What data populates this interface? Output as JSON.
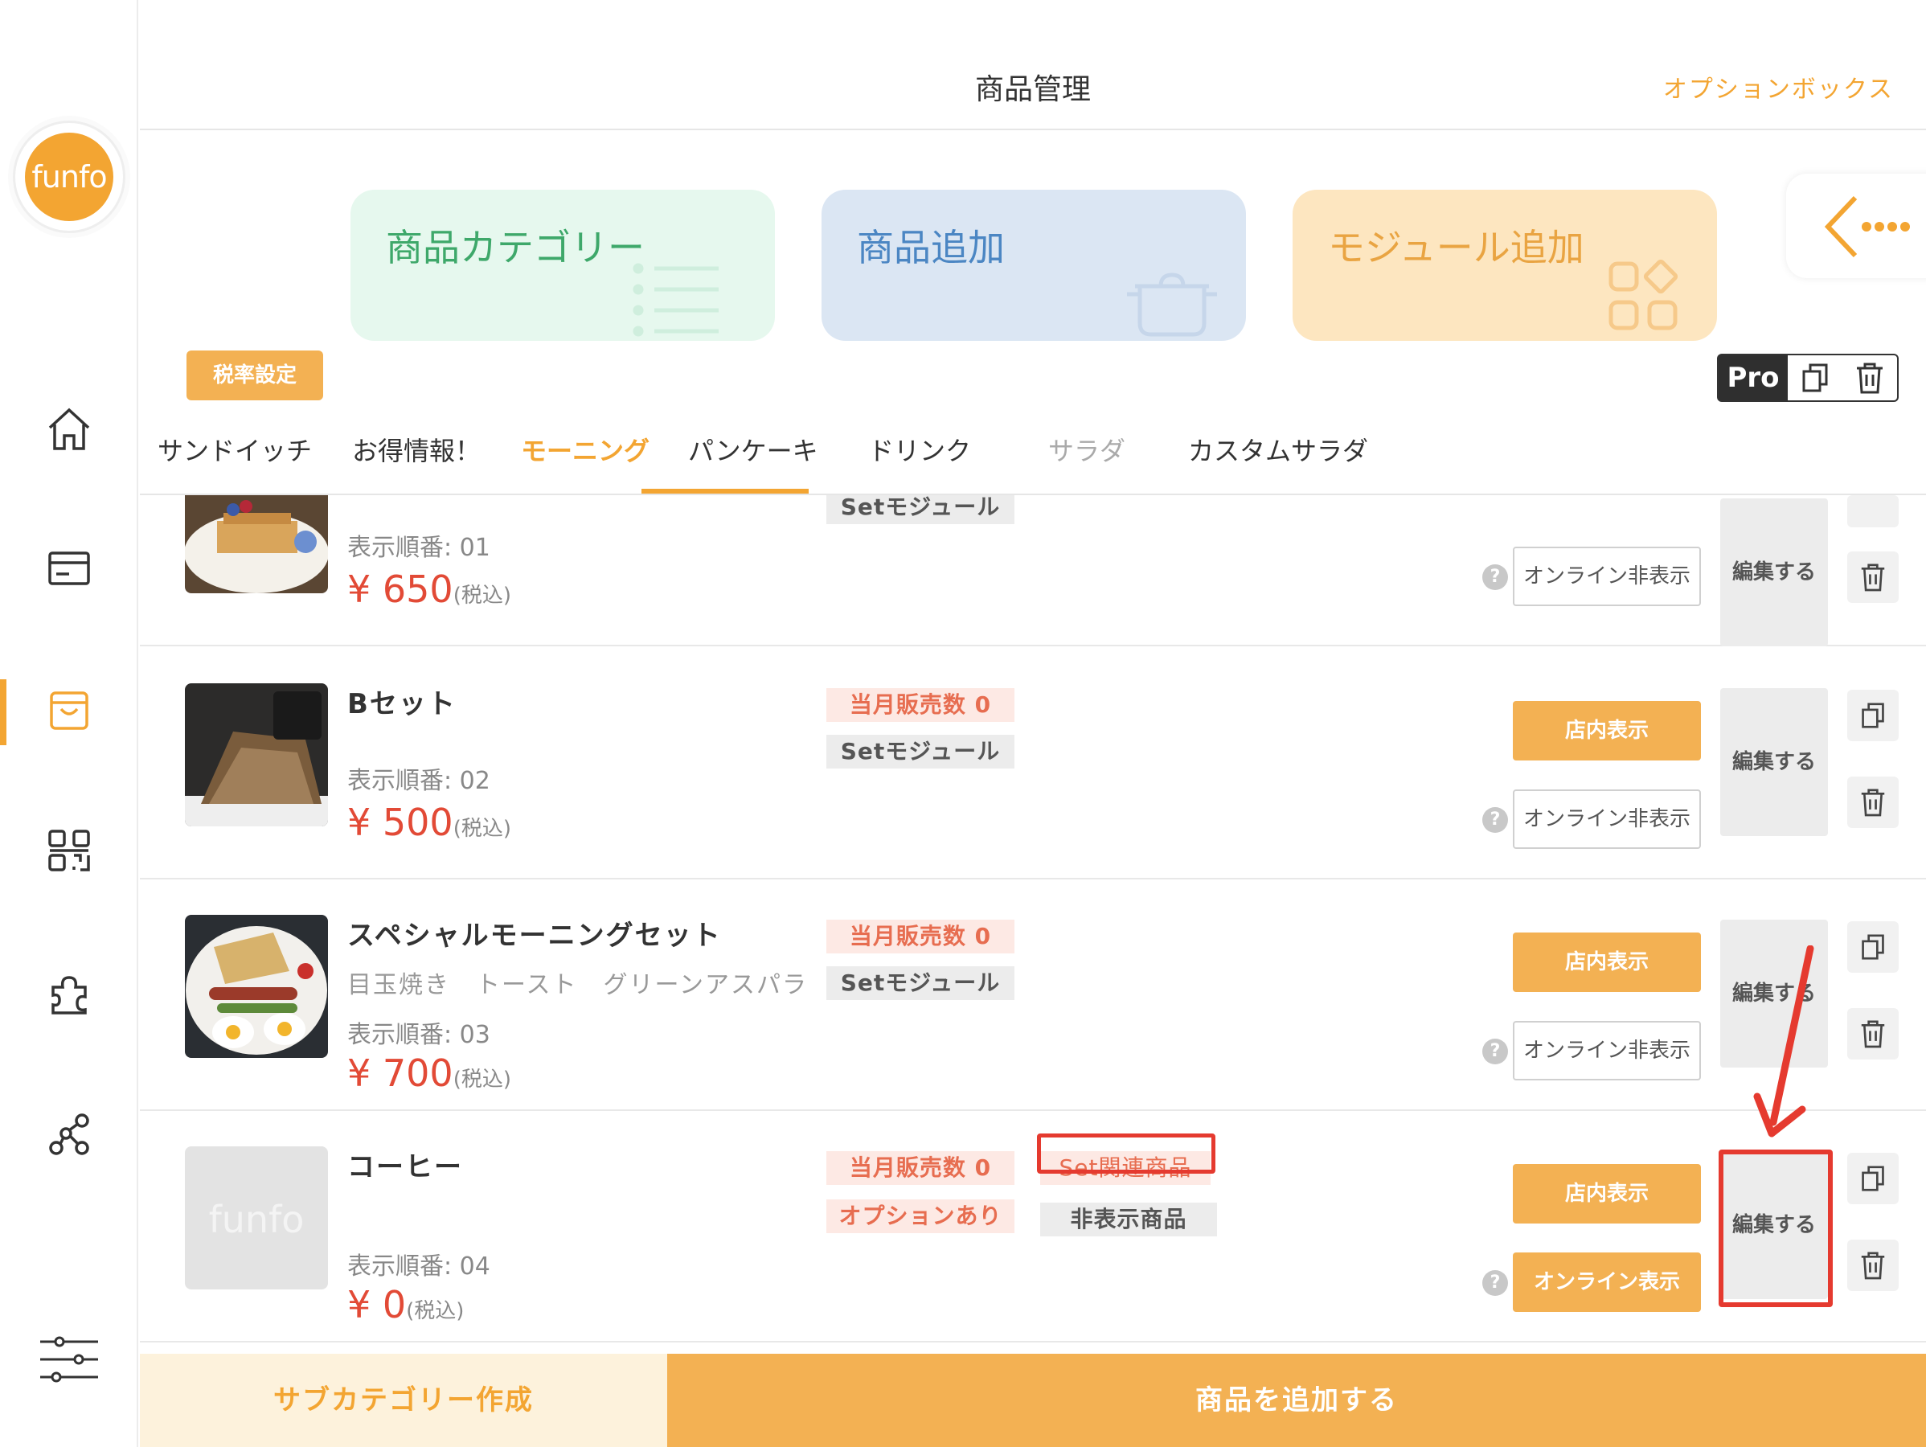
{
  "brand": {
    "logo_text": "funfo",
    "accent": "#f3a532",
    "highlight": "#e53a2f"
  },
  "header": {
    "title": "商品管理",
    "option_box": "オプションボックス"
  },
  "sidebar": {
    "icons": [
      "home-icon",
      "card-icon",
      "shopping-bag-icon",
      "qr-code-icon",
      "puzzle-icon",
      "network-icon",
      "sliders-icon"
    ],
    "active": "shopping-bag-icon"
  },
  "cards": {
    "category": "商品カテゴリー",
    "add_product": "商品追加",
    "add_module": "モジュール追加"
  },
  "toolbar": {
    "tax_setting": "税率設定",
    "pro": "Pro"
  },
  "tabs": [
    {
      "label": "サンドイッチ"
    },
    {
      "label": "お得情報！"
    },
    {
      "label": "モーニング"
    },
    {
      "label": "パンケーキ"
    },
    {
      "label": "ドリンク"
    },
    {
      "label": "サラダ"
    },
    {
      "label": "カスタムサラダ"
    }
  ],
  "products": [
    {
      "name": "",
      "order": "表示順番: 01",
      "price": "¥ 650",
      "tax": "(税込)",
      "tags": {
        "set": "Setモジュール"
      },
      "edit": "編集する",
      "online": "オンライン非表示"
    },
    {
      "name": "Bセット",
      "order": "表示順番: 02",
      "price": "¥ 500",
      "tax": "(税込)",
      "tags": {
        "sales": "当月販売数 0",
        "set": "Setモジュール"
      },
      "store": "店内表示",
      "online": "オンライン非表示",
      "edit": "編集する"
    },
    {
      "name": "スペシャルモーニングセット",
      "desc": "目玉焼き　トースト　グリーンアスパラ",
      "order": "表示順番: 03",
      "price": "¥ 700",
      "tax": "(税込)",
      "tags": {
        "sales": "当月販売数 0",
        "set": "Setモジュール"
      },
      "store": "店内表示",
      "online": "オンライン非表示",
      "edit": "編集する"
    },
    {
      "name": "コーヒー",
      "order": "表示順番: 04",
      "price": "¥ 0",
      "tax": "(税込)",
      "placeholder_logo": "funfo",
      "tags": {
        "sales": "当月販売数 0",
        "option": "オプションあり",
        "set_related": "Set関連商品",
        "hidden": "非表示商品"
      },
      "store": "店内表示",
      "online": "オンライン表示",
      "edit": "編集する"
    }
  ],
  "help_glyph": "?",
  "bottom": {
    "sub_category": "サブカテゴリー作成",
    "add_product": "商品を追加する"
  }
}
